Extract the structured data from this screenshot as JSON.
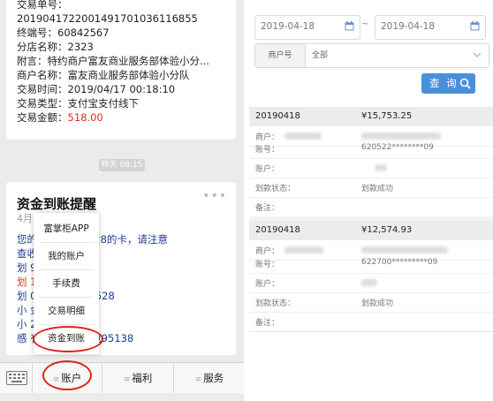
{
  "left": {
    "card1": {
      "lines": [
        {
          "label": "交易单号：",
          "value": ""
        },
        {
          "label": "",
          "value": "2019041722001491701036116855"
        },
        {
          "label": "终端号：",
          "value": "60842567"
        },
        {
          "label": "分店名称：",
          "value": "2323"
        },
        {
          "label": "附言：",
          "value": "特约商户富友商业服务部体验小分..."
        },
        {
          "label": "商户名称：",
          "value": "富友商业服务部体验小分队"
        },
        {
          "label": "交易时间：",
          "value": "2019/04/17 00:18:10"
        },
        {
          "label": "交易类型：",
          "value": "支付宝支付线下"
        },
        {
          "label": "交易金额：",
          "value": "518.00"
        }
      ]
    },
    "time_badge": "昨天 08:15",
    "card2": {
      "title": "资金到账提醒",
      "date": "4月17日",
      "lines": [
        "您的                款至尾号2528的卡，请注意",
        "查收",
        "划                9/04/17",
        "划                1",
        "划                02*********2528",
        "小                金：0.0",
        "小                20.0",
        "感                有需要，请致电95138"
      ]
    },
    "popup": [
      "富掌柜APP",
      "我的账户",
      "手续费",
      "交易明细",
      "资金到账"
    ],
    "tabs": [
      "账户",
      "福利",
      "服务"
    ]
  },
  "right": {
    "date_from": "2019-04-18",
    "date_sep": "~",
    "date_to": "2019-04-18",
    "merchant_label": "商户号",
    "merchant_value": "全部",
    "query_button": "查 询",
    "records": [
      {
        "date": "20190418",
        "amount": "¥15,753.25",
        "fields": [
          {
            "key": "商户：",
            "value": ""
          },
          {
            "key": "账号：",
            "value": "620522********09"
          },
          {
            "key": "账户：",
            "value": ""
          },
          {
            "key": "划款状态：",
            "value": "划款成功"
          },
          {
            "key": "备注：",
            "value": ""
          }
        ]
      },
      {
        "date": "20190418",
        "amount": "¥12,574.93",
        "fields": [
          {
            "key": "商户：",
            "value": ""
          },
          {
            "key": "账号：",
            "value": "622700*********09"
          },
          {
            "key": "账户：",
            "value": ""
          },
          {
            "key": "划款状态：",
            "value": "划款成功"
          },
          {
            "key": "备注：",
            "value": ""
          }
        ]
      }
    ]
  },
  "colors": {
    "accent": "#4a8fdc",
    "amount_red": "#e0301e",
    "circle_red": "#d9261c",
    "message_blue": "#1d3d8f"
  }
}
